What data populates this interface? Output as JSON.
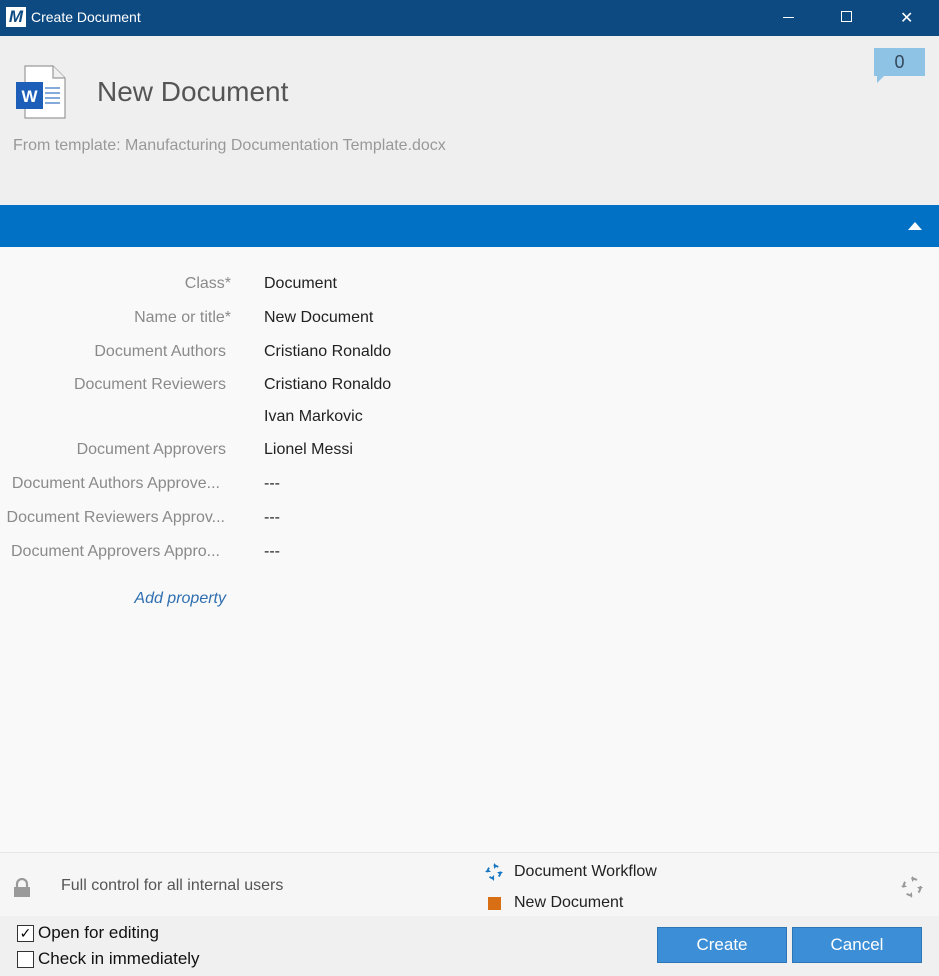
{
  "window": {
    "app_logo": "M",
    "title": "Create Document",
    "close_glyph": "✕"
  },
  "header": {
    "doc_title": "New Document",
    "template_line": "From template: Manufacturing Documentation Template.docx",
    "comment_count": "0",
    "doc_icon_letter": "W"
  },
  "properties": {
    "rows": [
      {
        "label": "Class*",
        "value": "Document"
      },
      {
        "label": "Name or title*",
        "value": "New Document"
      },
      {
        "label": "Document Authors",
        "value": "Cristiano Ronaldo"
      },
      {
        "label": "Document Reviewers",
        "value": "Cristiano Ronaldo"
      },
      {
        "label": "",
        "value": "Ivan Markovic"
      },
      {
        "label": "Document Approvers",
        "value": "Lionel Messi"
      },
      {
        "label": "Document Authors Approve...",
        "value": "---"
      },
      {
        "label": "Document Reviewers Approv...",
        "value": "---"
      },
      {
        "label": "Document Approvers Appro...",
        "value": "---"
      }
    ],
    "add_property": "Add property"
  },
  "footer": {
    "permissions": "Full control for all internal users",
    "workflow": "Document Workflow",
    "state": "New Document",
    "state_color": "#d86f14"
  },
  "bottom": {
    "open_for_editing": "Open for editing",
    "open_for_editing_checked": true,
    "check_in_immediately": "Check in immediately",
    "check_in_immediately_checked": false,
    "check_glyph": "✓",
    "create_label": "Create",
    "cancel_label": "Cancel"
  },
  "colors": {
    "titlebar": "#0e4a82",
    "accent_band": "#0071c5",
    "button": "#3c8fd6"
  }
}
